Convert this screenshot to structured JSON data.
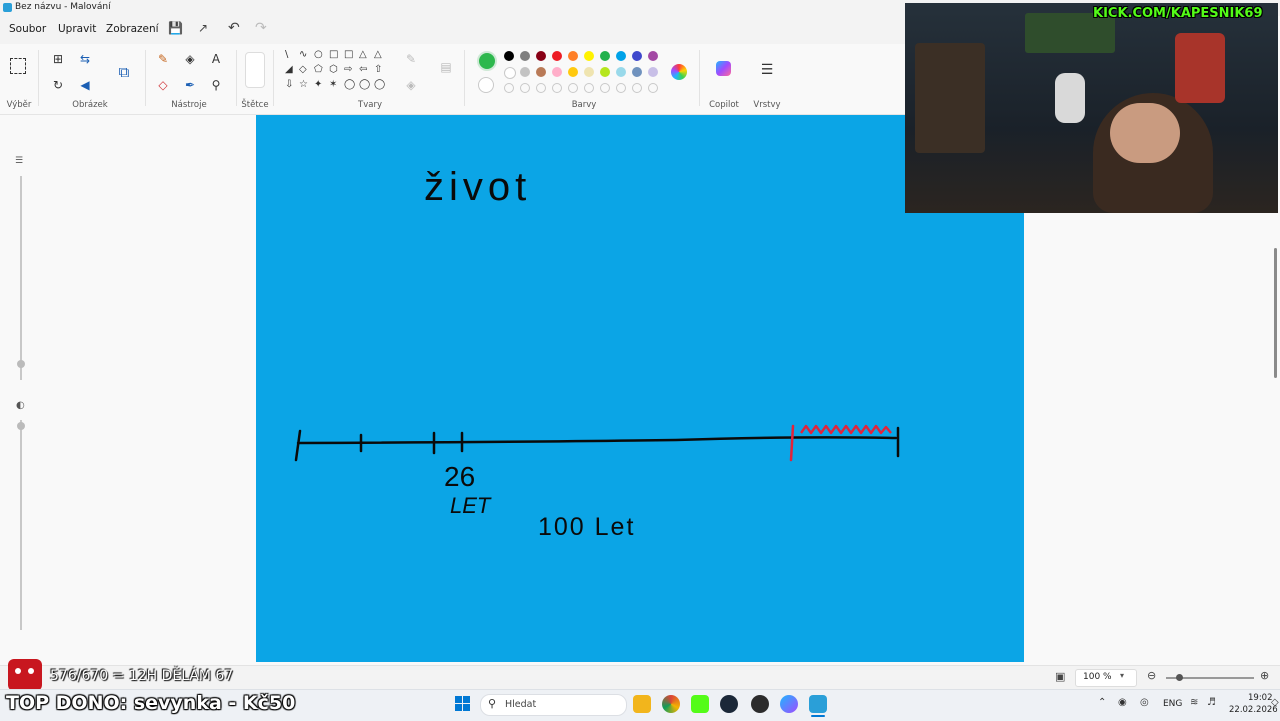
{
  "window": {
    "title": "Bez názvu - Malování"
  },
  "menu": {
    "file": "Soubor",
    "edit": "Upravit",
    "view": "Zobrazení"
  },
  "ribbon": {
    "groups": {
      "selection": "Výběr",
      "image": "Obrázek",
      "tools": "Nástroje",
      "brushes": "Štětce",
      "shapes": "Tvary",
      "colors": "Barvy",
      "copilot": "Copilot",
      "layers": "Vrstvy"
    },
    "active_color": "#2db84d",
    "palette_row1": [
      "#000000",
      "#7f7f7f",
      "#880015",
      "#ed1c24",
      "#ff7f27",
      "#fff200",
      "#22b14c",
      "#00a2e8",
      "#3f48cc",
      "#a349a4"
    ],
    "palette_row2": [
      "#ffffff",
      "#c3c3c3",
      "#b97a57",
      "#ffaec9",
      "#ffc90e",
      "#efe4b0",
      "#b5e61d",
      "#99d9ea",
      "#7092be",
      "#c8bfe7"
    ]
  },
  "canvas": {
    "background": "#0ba5e6",
    "handwriting": {
      "title": "život",
      "label_age": "26",
      "label_age_unit": "LET",
      "label_max": "100 Let"
    }
  },
  "statusbar": {
    "zoom": "100 %"
  },
  "overlay": {
    "webcam_banner": "KICK.COM/KAPESNIK69",
    "goal_text": "576/670 = 12H DĚLÁM 67",
    "top_donor": "TOP DONO: sevynka - Kč50"
  },
  "taskbar": {
    "search_placeholder": "Hledat",
    "language": "ENG",
    "time": "19:02",
    "date": "22.02.2026"
  }
}
